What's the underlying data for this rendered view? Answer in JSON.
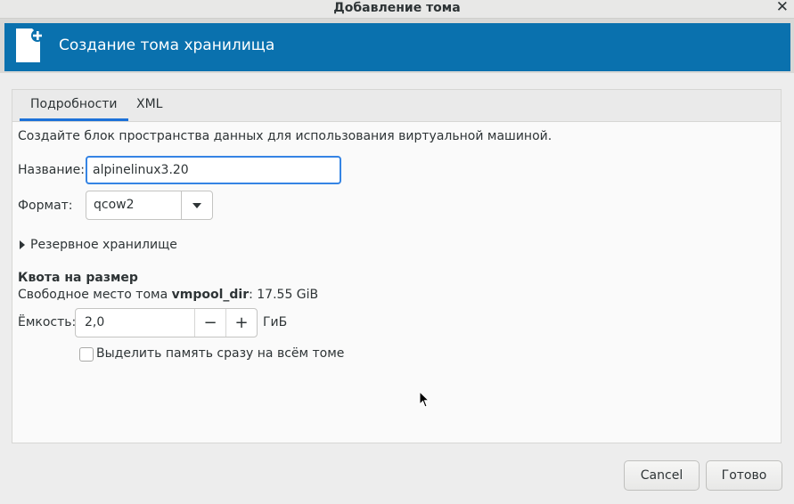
{
  "window": {
    "title": "Добавление тома",
    "close_glyph": "✕"
  },
  "banner": {
    "title": "Создание тома хранилища",
    "icon": "new-document-icon",
    "color": "#0a71ae"
  },
  "tabs": [
    {
      "label": "Подробности",
      "active": true
    },
    {
      "label": "XML",
      "active": false
    }
  ],
  "form": {
    "description": "Создайте блок пространства данных для использования виртуальной машиной.",
    "name_label": "Название:",
    "name_value": "alpinelinux3.20",
    "format_label": "Формат:",
    "format_value": "qcow2",
    "backing_label": "Резервное хранилище",
    "quota_title": "Квота на размер",
    "free_prefix": "Свободное место тома ",
    "free_pool": "vmpool_dir",
    "free_suffix": ": 17.55 GiB",
    "capacity_label": "Ёмкость:",
    "capacity_value": "2,0",
    "capacity_minus": "−",
    "capacity_plus": "+",
    "capacity_unit": "ГиБ",
    "allocate_label": "Выделить память сразу на всём томе",
    "allocate_checked": false
  },
  "buttons": {
    "cancel": "Cancel",
    "finish": "Готово"
  },
  "accent_color": "#3584e4"
}
